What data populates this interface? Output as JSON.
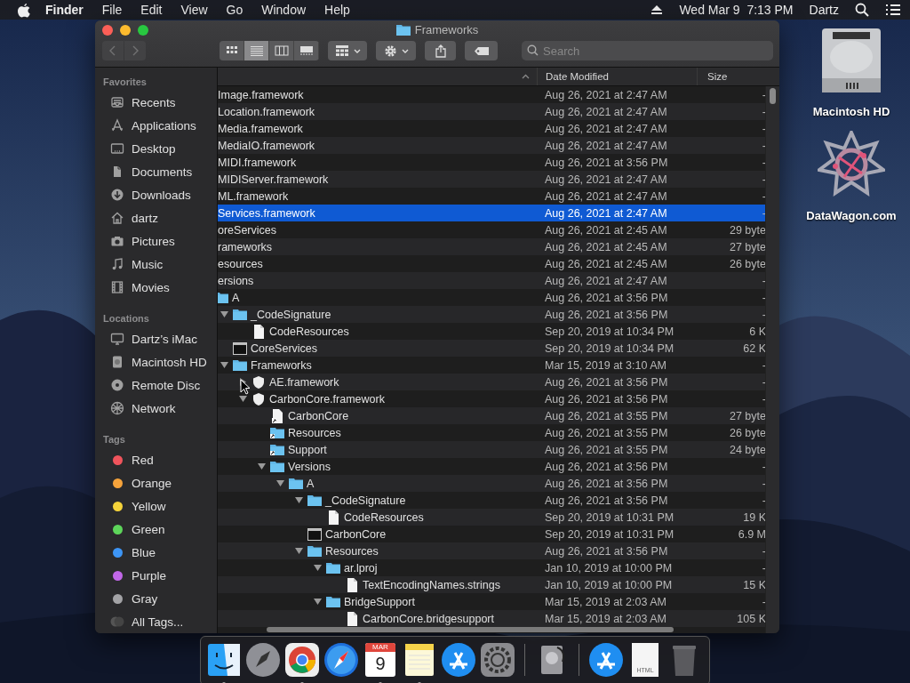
{
  "menu_bar": {
    "app": "Finder",
    "menus": [
      "File",
      "Edit",
      "View",
      "Go",
      "Window",
      "Help"
    ],
    "clock": "Wed Mar 9  7:13 PM",
    "user": "Dartz"
  },
  "window": {
    "title": "Frameworks",
    "toolbar": {
      "back_disabled": true,
      "forward_disabled": true,
      "view_modes": [
        {
          "selected": false
        },
        {
          "selected": true
        },
        {
          "selected": false
        },
        {
          "selected": false
        }
      ],
      "search": {
        "placeholder": "Search"
      }
    },
    "sidebar": [
      {
        "heading": "Favorites",
        "items": [
          {
            "label": "Recents",
            "kind": "recents"
          },
          {
            "label": "Applications",
            "kind": "applications"
          },
          {
            "label": "Desktop",
            "kind": "desktop"
          },
          {
            "label": "Documents",
            "kind": "documents"
          },
          {
            "label": "Downloads",
            "kind": "downloads"
          },
          {
            "label": "dartz",
            "kind": "home"
          },
          {
            "label": "Pictures",
            "kind": "pictures"
          },
          {
            "label": "Music",
            "kind": "music"
          },
          {
            "label": "Movies",
            "kind": "movies"
          }
        ]
      },
      {
        "heading": "Locations",
        "items": [
          {
            "label": "Dartz’s iMac",
            "kind": "computer"
          },
          {
            "label": "Macintosh HD",
            "kind": "disk"
          },
          {
            "label": "Remote Disc",
            "kind": "disc"
          },
          {
            "label": "Network",
            "kind": "network"
          }
        ]
      },
      {
        "heading": "Tags",
        "items": [
          {
            "label": "Red",
            "kind": "tag",
            "color": "#f0545c"
          },
          {
            "label": "Orange",
            "kind": "tag",
            "color": "#f6a33b"
          },
          {
            "label": "Yellow",
            "kind": "tag",
            "color": "#f5d33a"
          },
          {
            "label": "Green",
            "kind": "tag",
            "color": "#5dd55a"
          },
          {
            "label": "Blue",
            "kind": "tag",
            "color": "#3d95f5"
          },
          {
            "label": "Purple",
            "kind": "tag",
            "color": "#c167e8"
          },
          {
            "label": "Gray",
            "kind": "tag",
            "color": "#a3a3a6"
          },
          {
            "label": "All Tags...",
            "kind": "alltags"
          }
        ]
      }
    ],
    "name_column": {
      "sorted": true
    },
    "columns": [
      {
        "heading": "Date Modified"
      },
      {
        "heading": "Size"
      }
    ],
    "rows": [
      {
        "name": "Image.framework",
        "date": "Aug 26, 2021 at 2:47 AM",
        "size": "-",
        "selected": false
      },
      {
        "name": "Location.framework",
        "date": "Aug 26, 2021 at 2:47 AM",
        "size": "-",
        "selected": false
      },
      {
        "name": "Media.framework",
        "date": "Aug 26, 2021 at 2:47 AM",
        "size": "-",
        "selected": false
      },
      {
        "name": "MediaIO.framework",
        "date": "Aug 26, 2021 at 2:47 AM",
        "size": "-",
        "selected": false
      },
      {
        "name": "MIDI.framework",
        "date": "Aug 26, 2021 at 3:56 PM",
        "size": "-",
        "selected": false
      },
      {
        "name": "MIDIServer.framework",
        "date": "Aug 26, 2021 at 2:47 AM",
        "size": "-",
        "selected": false
      },
      {
        "name": "ML.framework",
        "date": "Aug 26, 2021 at 2:47 AM",
        "size": "-",
        "selected": false
      },
      {
        "name": "Services.framework",
        "date": "Aug 26, 2021 at 2:47 AM",
        "size": "-",
        "selected": true
      },
      {
        "name": "oreServices",
        "date": "Aug 26, 2021 at 2:45 AM",
        "size": "29 byte",
        "selected": false
      },
      {
        "name": "rameworks",
        "date": "Aug 26, 2021 at 2:45 AM",
        "size": "27 byte",
        "selected": false
      },
      {
        "name": "esources",
        "date": "Aug 26, 2021 at 2:45 AM",
        "size": "26 byte",
        "selected": false
      },
      {
        "name": "ersions",
        "date": "Aug 26, 2021 at 2:47 AM",
        "size": "-",
        "selected": false,
        "children": [
          {
            "name": "A",
            "kind": "folder",
            "date": "Aug 26, 2021 at 3:56 PM",
            "size": "-",
            "selected": false,
            "children": [
              {
                "name": "_CodeSignature",
                "kind": "folder",
                "expanded": true,
                "date": "Aug 26, 2021 at 3:56 PM",
                "size": "-",
                "selected": false,
                "children": [
                  {
                    "name": "CodeResources",
                    "kind": "file",
                    "date": "Sep 20, 2019 at 10:34 PM",
                    "size": "6 K",
                    "selected": false
                  }
                ]
              },
              {
                "name": "CoreServices",
                "kind": "executable",
                "date": "Sep 20, 2019 at 10:34 PM",
                "size": "62 K",
                "selected": false
              },
              {
                "name": "Frameworks",
                "kind": "folder",
                "expanded": true,
                "date": "Mar 15, 2019 at 3:10 AM",
                "size": "-",
                "selected": false,
                "children": [
                  {
                    "name": "AE.framework",
                    "kind": "bundle",
                    "expanded": false,
                    "date": "Aug 26, 2021 at 3:56 PM",
                    "size": "-",
                    "selected": false
                  },
                  {
                    "name": "CarbonCore.framework",
                    "kind": "bundle",
                    "expanded": true,
                    "date": "Aug 26, 2021 at 3:56 PM",
                    "size": "-",
                    "selected": false,
                    "children": [
                      {
                        "name": "CarbonCore",
                        "kind": "aliasfile",
                        "date": "Aug 26, 2021 at 3:55 PM",
                        "size": "27 byte",
                        "selected": false
                      },
                      {
                        "name": "Resources",
                        "kind": "aliasfolder",
                        "date": "Aug 26, 2021 at 3:55 PM",
                        "size": "26 byte",
                        "selected": false
                      },
                      {
                        "name": "Support",
                        "kind": "aliasfolder",
                        "date": "Aug 26, 2021 at 3:55 PM",
                        "size": "24 byte",
                        "selected": false
                      },
                      {
                        "name": "Versions",
                        "kind": "folder",
                        "expanded": true,
                        "date": "Aug 26, 2021 at 3:56 PM",
                        "size": "-",
                        "selected": false,
                        "children": [
                          {
                            "name": "A",
                            "kind": "folder",
                            "expanded": true,
                            "date": "Aug 26, 2021 at 3:56 PM",
                            "size": "-",
                            "selected": false,
                            "children": [
                              {
                                "name": "_CodeSignature",
                                "kind": "folder",
                                "expanded": true,
                                "date": "Aug 26, 2021 at 3:56 PM",
                                "size": "-",
                                "selected": false,
                                "children": [
                                  {
                                    "name": "CodeResources",
                                    "kind": "file",
                                    "date": "Sep 20, 2019 at 10:31 PM",
                                    "size": "19 K",
                                    "selected": false
                                  }
                                ]
                              },
                              {
                                "name": "CarbonCore",
                                "kind": "executable",
                                "date": "Sep 20, 2019 at 10:31 PM",
                                "size": "6.9 M",
                                "selected": false
                              },
                              {
                                "name": "Resources",
                                "kind": "folder",
                                "expanded": true,
                                "date": "Aug 26, 2021 at 3:56 PM",
                                "size": "-",
                                "selected": false,
                                "children": [
                                  {
                                    "name": "ar.lproj",
                                    "kind": "folder",
                                    "expanded": true,
                                    "date": "Jan 10, 2019 at 10:00 PM",
                                    "size": "-",
                                    "selected": false,
                                    "children": [
                                      {
                                        "name": "TextEncodingNames.strings",
                                        "kind": "file",
                                        "date": "Jan 10, 2019 at 10:00 PM",
                                        "size": "15 K",
                                        "selected": false
                                      }
                                    ]
                                  },
                                  {
                                    "name": "BridgeSupport",
                                    "kind": "folder",
                                    "expanded": true,
                                    "date": "Mar 15, 2019 at 2:03 AM",
                                    "size": "-",
                                    "selected": false,
                                    "children": [
                                      {
                                        "name": "CarbonCore.bridgesupport",
                                        "kind": "file",
                                        "date": "Mar 15, 2019 at 2:03 AM",
                                        "size": "105 K",
                                        "selected": false
                                      }
                                    ]
                                  }
                                ]
                              }
                            ]
                          }
                        ]
                      }
                    ]
                  }
                ]
              }
            ]
          }
        ]
      }
    ]
  },
  "desktop_icons": [
    {
      "label": "Macintosh HD",
      "kind": "disk"
    },
    {
      "label": "DataWagon.com",
      "kind": "star"
    }
  ],
  "dock": [
    {
      "kind": "finder",
      "running": true
    },
    {
      "kind": "launchpad",
      "running": false
    },
    {
      "kind": "browser",
      "running": true
    },
    {
      "kind": "compass",
      "running": false
    },
    {
      "kind": "calendar",
      "running": true,
      "month": "MAR",
      "day": "9"
    },
    {
      "kind": "notes",
      "running": true
    },
    {
      "kind": "appstore",
      "running": false
    },
    {
      "kind": "settings",
      "running": false
    },
    {
      "kind": "separator"
    },
    {
      "kind": "diskutility",
      "running": false
    },
    {
      "kind": "separator"
    },
    {
      "kind": "appstore2"
    },
    {
      "kind": "htmlfile",
      "label": "HTML"
    },
    {
      "kind": "trash"
    }
  ]
}
